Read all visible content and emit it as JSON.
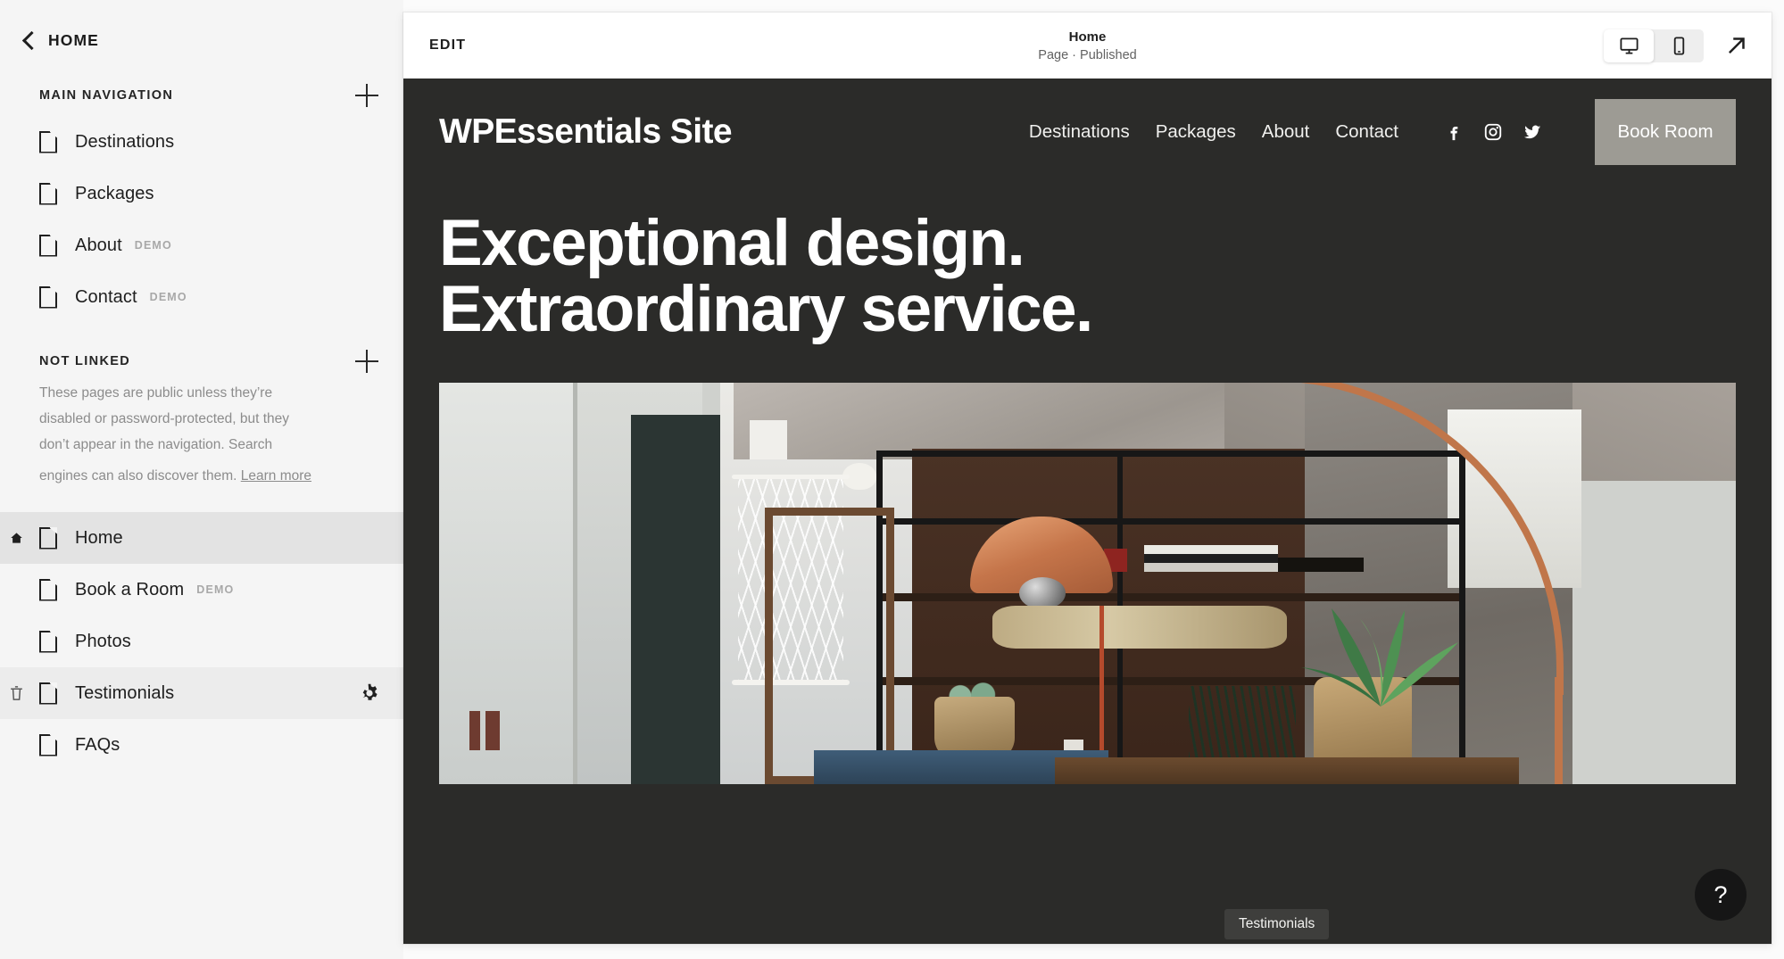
{
  "sidebar": {
    "back_label": "HOME",
    "sections": [
      {
        "title": "MAIN NAVIGATION",
        "items": [
          {
            "label": "Destinations",
            "tag": ""
          },
          {
            "label": "Packages",
            "tag": ""
          },
          {
            "label": "About",
            "tag": "DEMO"
          },
          {
            "label": "Contact",
            "tag": "DEMO"
          }
        ]
      },
      {
        "title": "NOT LINKED",
        "description": "These pages are public unless they’re disabled or password-protected, but they don’t appear in the navigation. Search engines can also discover them.",
        "learn_more": "Learn more",
        "items": [
          {
            "label": "Home",
            "tag": "",
            "state": "active",
            "is_homepage": true
          },
          {
            "label": "Book a Room",
            "tag": "DEMO",
            "state": ""
          },
          {
            "label": "Photos",
            "tag": "",
            "state": ""
          },
          {
            "label": "Testimonials",
            "tag": "",
            "state": "hovered"
          },
          {
            "label": "FAQs",
            "tag": "",
            "state": ""
          }
        ]
      }
    ]
  },
  "toolbar": {
    "edit_label": "EDIT",
    "page_title": "Home",
    "page_status": "Page · Published",
    "devices": [
      {
        "name": "desktop-view-button",
        "selected": true
      },
      {
        "name": "mobile-view-button",
        "selected": false
      }
    ],
    "open_external_label": "Open in new window"
  },
  "site": {
    "logo": "WPEssentials Site",
    "menu": [
      "Destinations",
      "Packages",
      "About",
      "Contact"
    ],
    "social": [
      "facebook-icon",
      "instagram-icon",
      "twitter-icon"
    ],
    "cta": "Book Room",
    "hero_line1": "Exceptional design.",
    "hero_line2": "Extraordinary service.",
    "background_color": "#2b2b29",
    "cta_color": "#9d9b94"
  },
  "overlay": {
    "tooltip": "Testimonials",
    "help_label": "?"
  }
}
